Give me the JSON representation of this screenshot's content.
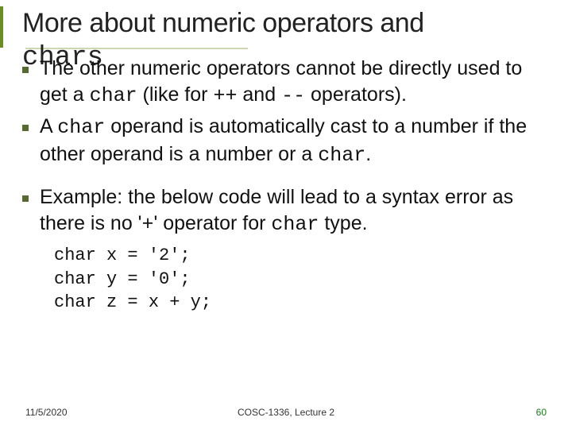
{
  "title_line": "More about numeric operators and",
  "title_overlap": "chars",
  "bullets": {
    "b1_pre": "The other numeric operators cannot be directly used to get a ",
    "b1_char": "char",
    "b1_mid": " (like for ",
    "b1_pp": "++",
    "b1_and": " and ",
    "b1_mm": "--",
    "b1_end": " operators).",
    "b2_pre": "A ",
    "b2_char1": "char",
    "b2_mid": " operand is automatically cast to a number if the other operand is a number or a ",
    "b2_char2": "char",
    "b2_end": ".",
    "b3_pre": "Example: the below code will lead to a syntax error as there is no '",
    "b3_plus": "+",
    "b3_mid": "' operator for ",
    "b3_char": "char",
    "b3_end": " type."
  },
  "code": {
    "l1": "char x = '2';",
    "l2": "char y = '0';",
    "l3": "char z = x + y;"
  },
  "footer": {
    "date": "11/5/2020",
    "mid": "COSC-1336, Lecture 2",
    "page": "60"
  }
}
